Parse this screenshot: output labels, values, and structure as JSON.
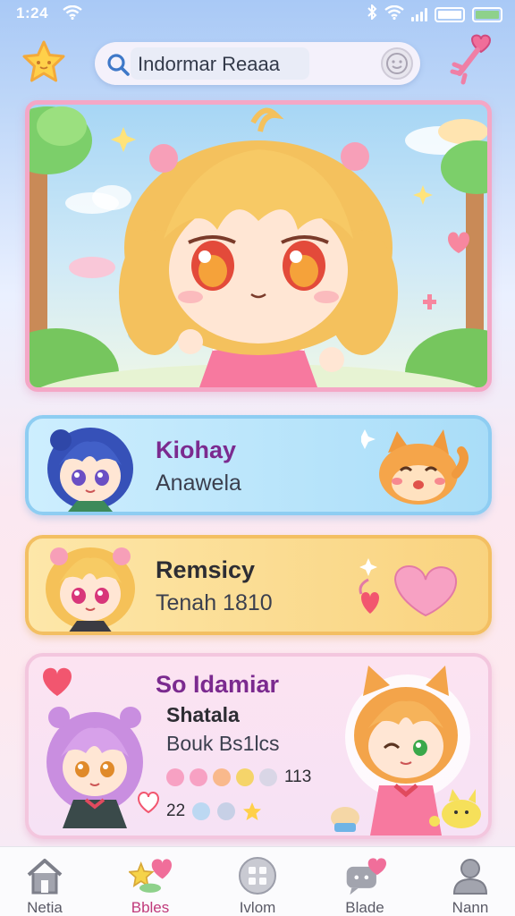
{
  "status_bar": {
    "time": "1:24"
  },
  "search": {
    "query": "Indormar Reaaa"
  },
  "cards": [
    {
      "title": "Kiohay",
      "subtitle": "Anawela"
    },
    {
      "title": "Remsicy",
      "subtitle": "Tenah 1810"
    },
    {
      "title": "So Idamiar",
      "subtitle": "Shatala",
      "detail": "Bouk Bs1lcs",
      "stat_count": "113",
      "stat_small": "22"
    }
  ],
  "nav": [
    {
      "label": "Netia",
      "icon": "home-icon"
    },
    {
      "label": "Bbles",
      "icon": "star-heart-icon"
    },
    {
      "label": "Ivlom",
      "icon": "grid-icon"
    },
    {
      "label": "Blade",
      "icon": "chat-heart-icon"
    },
    {
      "label": "Nann",
      "icon": "person-icon"
    }
  ],
  "colors": {
    "accent_pink": "#f4a7c6",
    "card_blue": "#a9ddf8",
    "card_yellow": "#f9d37f",
    "card_pink": "#fce3f1",
    "title_purple": "#7b2a8f"
  }
}
